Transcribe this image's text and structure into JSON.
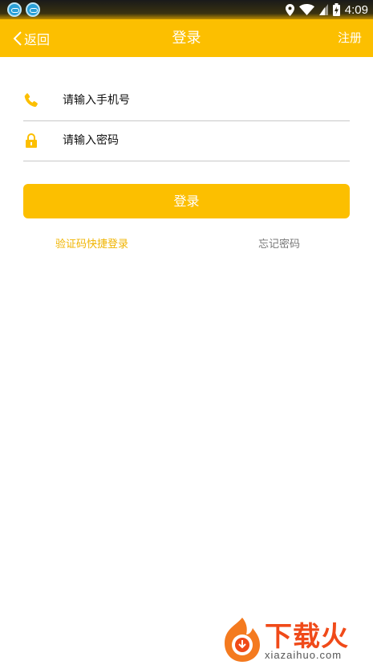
{
  "status_bar": {
    "time": "4:09",
    "icons": [
      "app-icon",
      "app-icon",
      "location-icon",
      "wifi-icon",
      "signal-icon",
      "battery-icon"
    ]
  },
  "header": {
    "back_label": "返回",
    "title": "登录",
    "register_label": "注册",
    "background": "#fcbf00"
  },
  "form": {
    "phone": {
      "icon": "phone-icon",
      "placeholder": "请输入手机号",
      "value": ""
    },
    "password": {
      "icon": "lock-icon",
      "placeholder": "请输入密码",
      "value": ""
    },
    "login_button": "登录"
  },
  "links": {
    "sms_login": "验证码快捷登录",
    "forgot_password": "忘记密码"
  },
  "watermark": {
    "brand": "下载火",
    "domain": "xiazaihuo.com"
  },
  "colors": {
    "accent": "#fcbf00",
    "link_accent": "#f0b400",
    "muted": "#777777"
  }
}
